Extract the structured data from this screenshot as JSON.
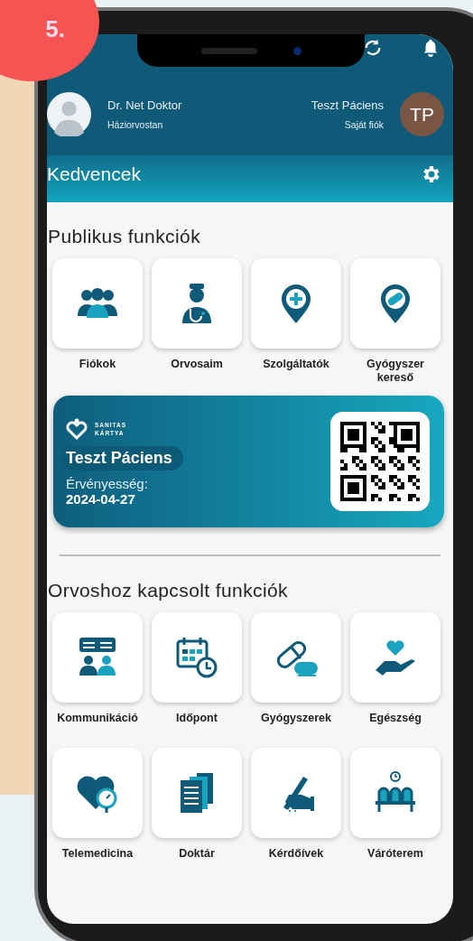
{
  "badge": {
    "text": "5."
  },
  "header": {
    "doctor": {
      "name": "Dr. Net Doktor",
      "role": "Háziorvostan"
    },
    "patient": {
      "name": "Teszt Páciens",
      "subtitle": "Saját fiók",
      "initials": "TP"
    }
  },
  "favorites_bar": {
    "title": "Kedvencek"
  },
  "public_section": {
    "title": "Publikus funkciók",
    "items": [
      {
        "label": "Fiókok"
      },
      {
        "label": "Orvosaim"
      },
      {
        "label": "Szolgáltatók"
      },
      {
        "label": "Gyógyszer kereső"
      }
    ]
  },
  "card": {
    "brand_line_1": "SANITAS",
    "brand_line_2": "KÁRTYA",
    "name": "Teszt Páciens",
    "validity_label": "Érvényesség:",
    "validity_date": "2024-04-27"
  },
  "doctor_section": {
    "title": "Orvoshoz kapcsolt funkciók",
    "items": [
      {
        "label": "Kommunikáció"
      },
      {
        "label": "Időpont"
      },
      {
        "label": "Gyógyszerek"
      },
      {
        "label": "Egészség"
      },
      {
        "label": "Telemedicina"
      },
      {
        "label": "Doktár"
      },
      {
        "label": "Kérdőívek"
      },
      {
        "label": "Váróterem"
      }
    ]
  }
}
